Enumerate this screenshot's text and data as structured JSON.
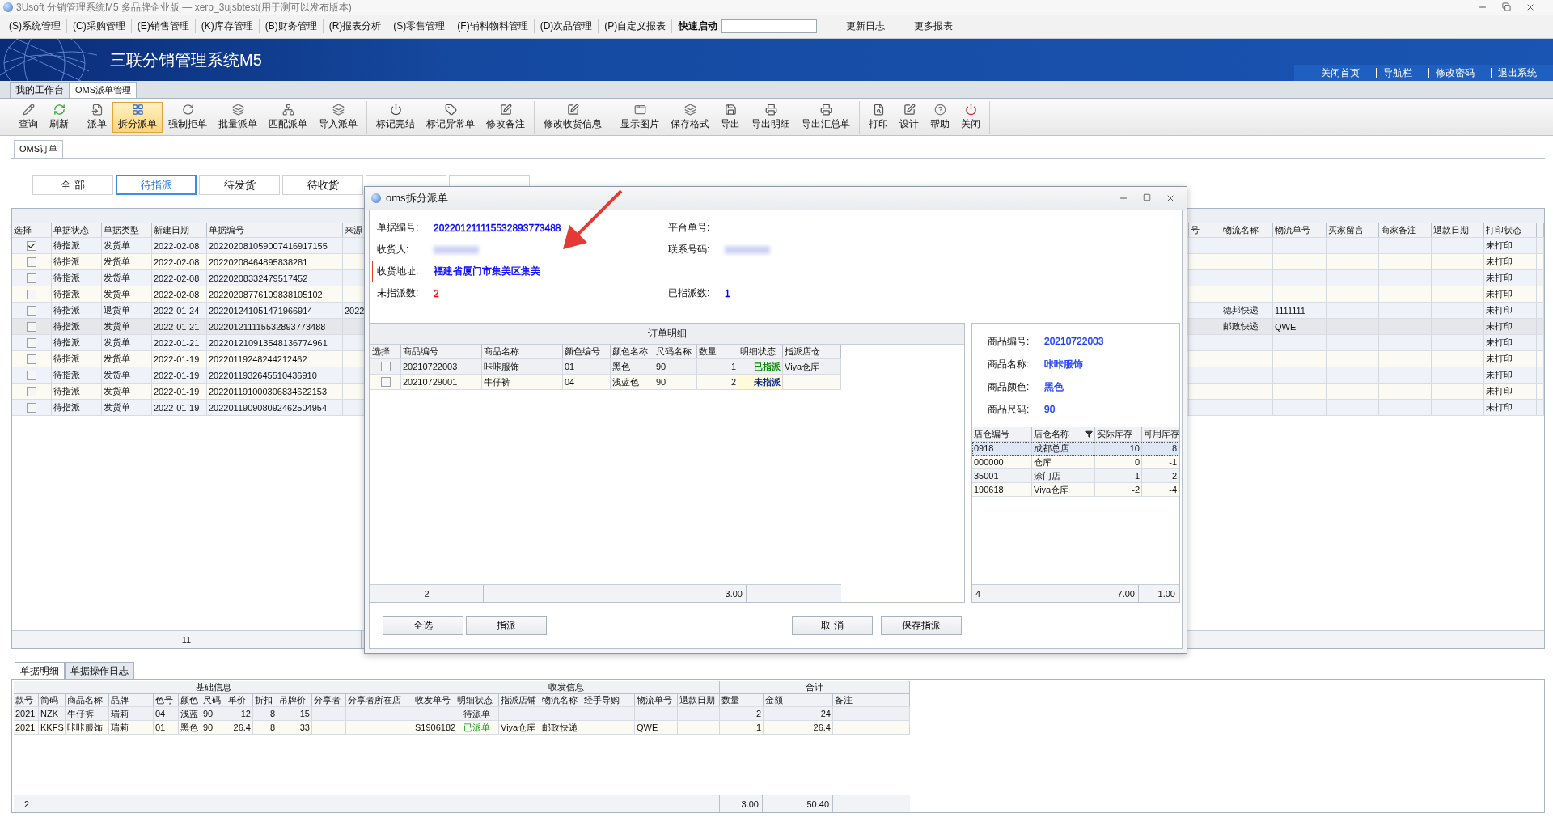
{
  "window": {
    "title": "3Usoft 分销管理系统M5 多品牌企业版 — xerp_3ujsbtest(用于测可以发布版本)"
  },
  "menu": {
    "items": [
      {
        "label": "(S)系统管理"
      },
      {
        "label": "(C)采购管理"
      },
      {
        "label": "(E)销售管理"
      },
      {
        "label": "(K)库存管理"
      },
      {
        "label": "(B)财务管理"
      },
      {
        "label": "(R)报表分析"
      },
      {
        "label": "(S)零售管理"
      },
      {
        "label": "(F)辅料物料管理"
      },
      {
        "label": "(D)次品管理"
      },
      {
        "label": "(P)自定义报表"
      }
    ],
    "quick_launch": "快速启动",
    "links": [
      "更新日志",
      "更多报表"
    ]
  },
  "banner": {
    "title": "三联分销管理系统M5",
    "links": [
      "关闭首页",
      "导航栏",
      "修改密码",
      "退出系统"
    ]
  },
  "tabs": [
    {
      "label": "我的工作台",
      "selected": false
    },
    {
      "label": "OMS派单管理",
      "selected": true
    }
  ],
  "toolbar": [
    {
      "items": [
        {
          "label": "查询",
          "selected": false
        },
        {
          "label": "刷新",
          "selected": false
        }
      ]
    },
    {
      "items": [
        {
          "label": "派单",
          "selected": false
        },
        {
          "label": "拆分派单",
          "selected": true
        },
        {
          "label": "强制拒单",
          "selected": false
        },
        {
          "label": "批量派单",
          "selected": false
        },
        {
          "label": "匹配派单",
          "selected": false
        },
        {
          "label": "导入派单",
          "selected": false
        }
      ]
    },
    {
      "items": [
        {
          "label": "标记完结",
          "selected": false
        },
        {
          "label": "标记异常单",
          "selected": false
        },
        {
          "label": "修改备注",
          "selected": false
        }
      ]
    },
    {
      "items": [
        {
          "label": "修改收货信息",
          "selected": false
        }
      ]
    },
    {
      "items": [
        {
          "label": "显示图片",
          "selected": false
        },
        {
          "label": "保存格式",
          "selected": false
        },
        {
          "label": "导出",
          "selected": false
        },
        {
          "label": "导出明细",
          "selected": false
        },
        {
          "label": "导出汇总单",
          "selected": false
        }
      ]
    },
    {
      "items": [
        {
          "label": "打印",
          "selected": false
        },
        {
          "label": "设计",
          "selected": false
        },
        {
          "label": "帮助",
          "selected": false
        },
        {
          "label": "关闭",
          "selected": false
        }
      ]
    }
  ],
  "sub_tabs": [
    {
      "label": "OMS订单",
      "selected": true
    }
  ],
  "filters": [
    {
      "label": "全 部",
      "selected": false
    },
    {
      "label": "待指派",
      "selected": true
    },
    {
      "label": "待发货",
      "selected": false
    },
    {
      "label": "待收货",
      "selected": false
    }
  ],
  "orders": {
    "columns_left": [
      "选择",
      "单据状态",
      "单据类型",
      "新建日期",
      "单据编号",
      "来源"
    ],
    "columns_right": [
      "号",
      "物流名称",
      "物流单号",
      "买家留言",
      "商家备注",
      "退款日期",
      "打印状态"
    ],
    "rows": [
      {
        "checked": true,
        "selected": false,
        "status": "待指派",
        "type": "发货单",
        "date": "2022-02-08",
        "number": "202202081059007416917155",
        "print_status": "未打印"
      },
      {
        "checked": false,
        "selected": false,
        "status": "待指派",
        "type": "发货单",
        "date": "2022-02-08",
        "number": "20220208464895838281",
        "print_status": "未打印"
      },
      {
        "checked": false,
        "selected": false,
        "status": "待指派",
        "type": "发货单",
        "date": "2022-02-08",
        "number": "20220208332479517452",
        "print_status": "未打印"
      },
      {
        "checked": false,
        "selected": false,
        "status": "待指派",
        "type": "发货单",
        "date": "2022-02-08",
        "number": "20220208776109838105102",
        "print_status": "未打印"
      },
      {
        "checked": false,
        "selected": false,
        "status": "待指派",
        "type": "退货单",
        "date": "2022-01-24",
        "number": "202201241051471966914",
        "source": "2022",
        "carrier": "德邦快递",
        "tracking": "1111111",
        "print_status": "未打印"
      },
      {
        "checked": false,
        "selected": true,
        "status": "待指派",
        "type": "发货单",
        "date": "2022-01-21",
        "number": "202201211115532893773488",
        "carrier": "邮政快递",
        "tracking": "QWE",
        "print_status": "未打印"
      },
      {
        "checked": false,
        "selected": false,
        "status": "待指派",
        "type": "发货单",
        "date": "2022-01-21",
        "number": "202201210913548136774961",
        "print_status": "未打印"
      },
      {
        "checked": false,
        "selected": false,
        "status": "待指派",
        "type": "发货单",
        "date": "2022-01-19",
        "number": "20220119248244212462",
        "print_status": "未打印"
      },
      {
        "checked": false,
        "selected": false,
        "status": "待指派",
        "type": "发货单",
        "date": "2022-01-19",
        "number": "2022011932645510436910",
        "print_status": "未打印"
      },
      {
        "checked": false,
        "selected": false,
        "status": "待指派",
        "type": "发货单",
        "date": "2022-01-19",
        "number": "202201191000306834622153",
        "print_status": "未打印"
      },
      {
        "checked": false,
        "selected": false,
        "status": "待指派",
        "type": "发货单",
        "date": "2022-01-19",
        "number": "202201190908092462504954",
        "print_status": "未打印"
      }
    ],
    "footer": "11"
  },
  "dialog": {
    "title": "oms拆分派单",
    "info_rows": [
      {
        "left": {
          "label": "单据编号:",
          "value": "202201211115532893773488",
          "color": "#0000ff"
        },
        "right": {
          "label": "平台单号:"
        }
      },
      {
        "left": {
          "label": "收货人:",
          "value_blurred": true
        },
        "right": {
          "label": "联系号码:",
          "value_blurred": true
        }
      },
      {
        "left": {
          "label": "收货地址:",
          "value": "福建省厦门市集美区集美",
          "color": "#0000ff",
          "highlighted": true
        }
      },
      {
        "left": {
          "label": "未指派数:",
          "value": "2",
          "color": "#ff0000"
        },
        "right": {
          "label": "已指派数:",
          "value": "1",
          "color": "#0000ff"
        }
      }
    ],
    "details": {
      "title": "订单明细",
      "columns": [
        "选择",
        "商品编号",
        "商品名称",
        "颜色编号",
        "颜色名称",
        "尺码名称",
        "数量",
        "明细状态",
        "指派店仓"
      ],
      "rows": [
        {
          "checked": false,
          "code": "20210722003",
          "name": "咔咔服饰",
          "color_code": "01",
          "color_name": "黑色",
          "size": "90",
          "qty": "1",
          "status": "已指派",
          "kind": "assigned",
          "store": "Viya仓库"
        },
        {
          "checked": false,
          "code": "20210729001",
          "name": "牛仔裤",
          "color_code": "04",
          "color_name": "浅蓝色",
          "size": "90",
          "qty": "2",
          "status": "未指派",
          "kind": "unassigned"
        }
      ],
      "footer": {
        "count": "2",
        "qty": "3.00"
      }
    },
    "product": [
      {
        "label": "商品编号:",
        "value": "20210722003"
      },
      {
        "label": "商品名称:",
        "value": "咔咔服饰"
      },
      {
        "label": "商品颜色:",
        "value": "黑色"
      },
      {
        "label": "商品尺码:",
        "value": "90"
      }
    ],
    "stock": {
      "columns": [
        "店仓编号",
        "店仓名称",
        "实际库存",
        "可用库存"
      ],
      "rows": [
        {
          "selected": true,
          "code": "0918",
          "name": "成都总店",
          "actual": "10",
          "available": "8"
        },
        {
          "selected": false,
          "code": "000000",
          "name": "仓库",
          "actual": "0",
          "available": "-1"
        },
        {
          "selected": false,
          "code": "35001",
          "name": "涂门店",
          "actual": "-1",
          "available": "-2"
        },
        {
          "selected": false,
          "code": "190618",
          "name": "Viya仓库",
          "actual": "-2",
          "available": "-4"
        }
      ],
      "footer": {
        "count": "4",
        "actual": "7.00",
        "available": "1.00"
      }
    },
    "buttons_left": [
      "全选",
      "指派"
    ],
    "buttons_right": [
      "取 消",
      "保存指派"
    ]
  },
  "bottom": {
    "tabs": [
      {
        "label": "单据明细",
        "selected": true
      },
      {
        "label": "单据操作日志",
        "selected": false
      }
    ],
    "groups": [
      "基础信息",
      "收发信息",
      "合计"
    ],
    "columns": [
      "款号",
      "简码",
      "商品名称",
      "品牌",
      "色号",
      "颜色",
      "尺码",
      "单价",
      "折扣",
      "吊牌价",
      "分享者",
      "分享者所在店",
      "收发单号",
      "明细状态",
      "指派店铺",
      "物流名称",
      "经手导购",
      "物流单号",
      "退款日期",
      "数量",
      "金额",
      "备注"
    ],
    "rows": [
      {
        "style_no": "2021",
        "short_code": "NZK",
        "name": "牛仔裤",
        "brand": "瑞莉",
        "color_no": "04",
        "color_name": "浅蓝",
        "size": "90",
        "price": "12",
        "discount": "8",
        "tag_price": "15",
        "status": "待派单",
        "kind": "pending",
        "qty": "2",
        "amount": "24"
      },
      {
        "style_no": "2021",
        "short_code": "KKFS",
        "name": "咔咔服饰",
        "brand": "瑞莉",
        "color_no": "01",
        "color_name": "黑色",
        "size": "90",
        "price": "26.4",
        "discount": "8",
        "tag_price": "33",
        "doc_no": "S1906182",
        "status": "已派单",
        "kind": "dispatched",
        "store": "Viya仓库",
        "carrier": "邮政快递",
        "tracking": "QWE",
        "qty": "1",
        "amount": "26.4"
      }
    ],
    "footer": {
      "count": "2",
      "qty": "3.00",
      "amount": "50.40"
    }
  }
}
